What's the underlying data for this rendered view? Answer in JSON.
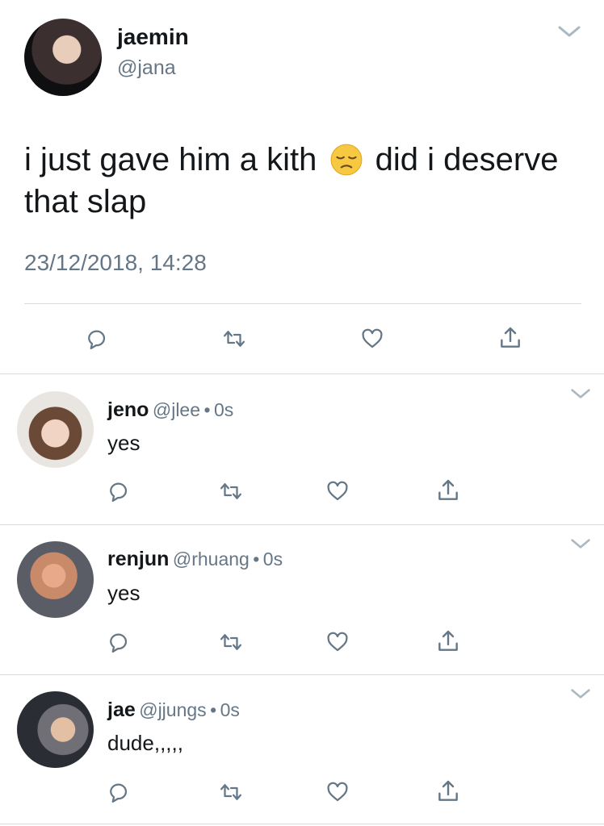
{
  "main_tweet": {
    "display_name": "jaemin",
    "handle": "@jana",
    "text_before": "i just gave him a kith",
    "emoji": "pensive-face",
    "text_after": "did i deserve",
    "text_line2": "that slap",
    "timestamp": "23/12/2018, 14:28"
  },
  "replies": [
    {
      "display_name": "jeno",
      "handle": "@jlee",
      "dot": "•",
      "time": "0s",
      "text": "yes"
    },
    {
      "display_name": "renjun",
      "handle": "@rhuang",
      "dot": "•",
      "time": "0s",
      "text": "yes"
    },
    {
      "display_name": "jae",
      "handle": "@jjungs",
      "dot": "•",
      "time": "0s",
      "text": "dude,,,,,"
    }
  ],
  "colors": {
    "icon": "#657786",
    "divider": "#d7dbde",
    "text": "#14171a"
  }
}
